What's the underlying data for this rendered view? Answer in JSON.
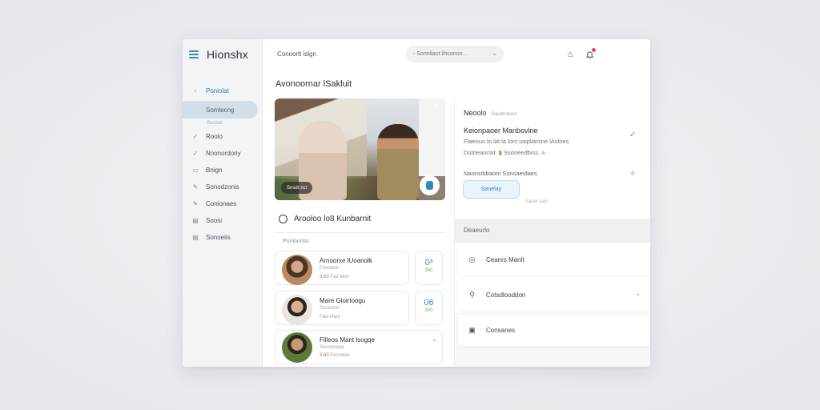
{
  "app": {
    "logo": "Hionshx",
    "menu_icon": "hamburger-icon"
  },
  "sidebar": {
    "items": [
      {
        "label": "Poniolat",
        "icon": "grid-icon",
        "state": "active"
      },
      {
        "label": "Somlecng",
        "icon": "",
        "state": "selected"
      },
      {
        "label": "Sucstol",
        "icon": "",
        "state": "sub"
      },
      {
        "label": "Roolo",
        "icon": "check-icon"
      },
      {
        "label": "Noonordoriy",
        "icon": "check-icon"
      },
      {
        "label": "Bnign",
        "icon": "square-icon"
      },
      {
        "label": "Sonodzonis",
        "icon": "pen-icon"
      },
      {
        "label": "Conionaes",
        "icon": "pen-icon"
      },
      {
        "label": "Soosi",
        "icon": "doc-icon"
      },
      {
        "label": "Sonoeiis",
        "icon": "list-icon"
      }
    ]
  },
  "topbar": {
    "breadcrumb": "Conoorlt lslgn",
    "select_value": "- Sonnliaot lihconon...",
    "icons": [
      "home-icon",
      "bell-icon",
      "avatar",
      "search-toggle-icon"
    ]
  },
  "main": {
    "title": "Avonoornar lSakluit",
    "hero": {
      "badge": "Snsdr:ncl",
      "play_icon": "play-icon"
    },
    "section": {
      "title": "Arooloo lo8 Kunbarnit",
      "subtitle": "Poniooriss",
      "rows": [
        {
          "name": "Arnoorxe lUoanolk",
          "sub1": "Fnooooe",
          "sub2_accent": "3.60",
          "sub2": "Fad lelor",
          "stat_value": "0³",
          "stat_sub": "300"
        },
        {
          "name": "Mare Gioirtoogu",
          "sub1": "Sonsomn",
          "sub2_accent": "",
          "sub2": "Fad-nhes",
          "stat_value": "06",
          "stat_sub": "300"
        },
        {
          "name": "Filleos Mant lsogqe",
          "sub1": "Socoonoaa",
          "sub2_accent": "3.60",
          "sub2": "Fonsoles",
          "stat_value": "",
          "stat_sub": ""
        }
      ]
    }
  },
  "right_panel": {
    "header": "Neoolo",
    "header_sub": "Raodosbars",
    "title": "Keionpaoer Manbovlne",
    "text1": "Flaeouo lo lat la lorc:saipliarsne lAslnes",
    "text2_a": "Dutoeaocixt.",
    "text2_b": "Ssooeedbiss.",
    "text2_c": "a",
    "label": "Naonsibbaom Sonsaeidaes",
    "button": "Sanelay",
    "caption": "Saoer.saiir",
    "band": "Deaeurlo",
    "cards": [
      {
        "label": "Ceanrs Manlt",
        "icon": "circle-icon"
      },
      {
        "label": "Cotsdlooddon",
        "icon": "pin-icon"
      },
      {
        "label": "Consanes",
        "icon": "box-icon"
      }
    ]
  }
}
